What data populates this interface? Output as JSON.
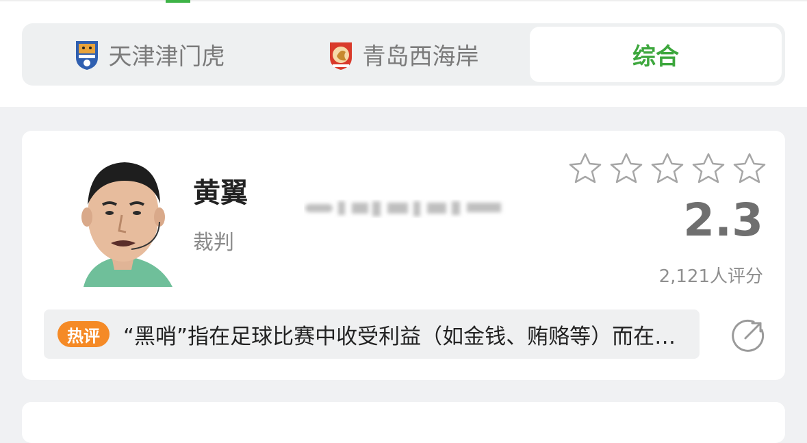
{
  "tabs": [
    {
      "label": "天津津门虎",
      "icon": "tianjin-tigers-crest-icon",
      "active": false
    },
    {
      "label": "青岛西海岸",
      "icon": "qingdao-west-coast-crest-icon",
      "active": false
    },
    {
      "label": "综合",
      "active": true
    }
  ],
  "card": {
    "name": "黄翼",
    "role": "裁判",
    "rating_stars": 0,
    "rating_max": 5,
    "score": "2.3",
    "rating_count": "2,121人评分",
    "hot_badge": "热评",
    "hot_comment": "“黑哨”指在足球比赛中收受利益（如金钱、贿赂等）而在比赛中偏袒一方的裁判",
    "share_icon": "share-arrow-icon"
  },
  "colors": {
    "accent_green": "#3da73d",
    "hot_orange": "#f58a26",
    "score_gray": "#6f6f6f",
    "page_bg": "#f0f1f3"
  }
}
